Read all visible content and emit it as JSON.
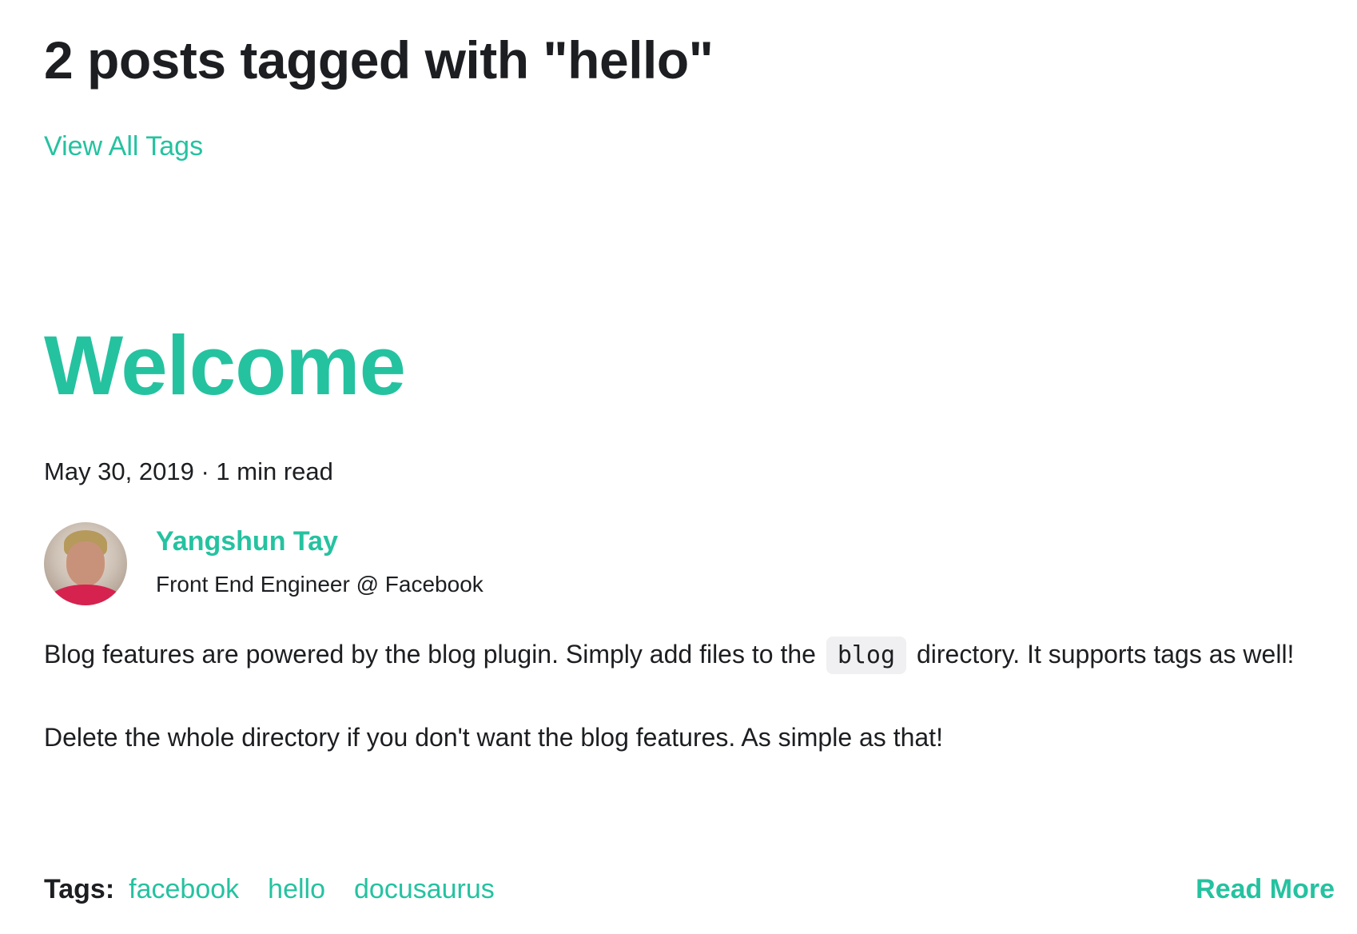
{
  "header": {
    "title": "2 posts tagged with \"hello\"",
    "view_all_tags": "View All Tags"
  },
  "post": {
    "title": "Welcome",
    "date": "May 30, 2019",
    "separator": " · ",
    "read_time": "1 min read",
    "author": {
      "name": "Yangshun Tay",
      "role": "Front End Engineer @ Facebook",
      "avatar_icon": "author-avatar-photo"
    },
    "paragraph1": {
      "before": "Blog features are powered by the blog plugin. Simply add files to the ",
      "code": "blog",
      "after": " directory. It supports tags as well!"
    },
    "paragraph2": "Delete the whole directory if you don't want the blog features. As simple as that!",
    "tags_label": "Tags:",
    "tags": [
      "facebook",
      "hello",
      "docusaurus"
    ],
    "read_more": "Read More"
  },
  "colors": {
    "accent": "#25c2a0",
    "text": "#1c1e21",
    "code_bg": "#f0f0f2"
  }
}
